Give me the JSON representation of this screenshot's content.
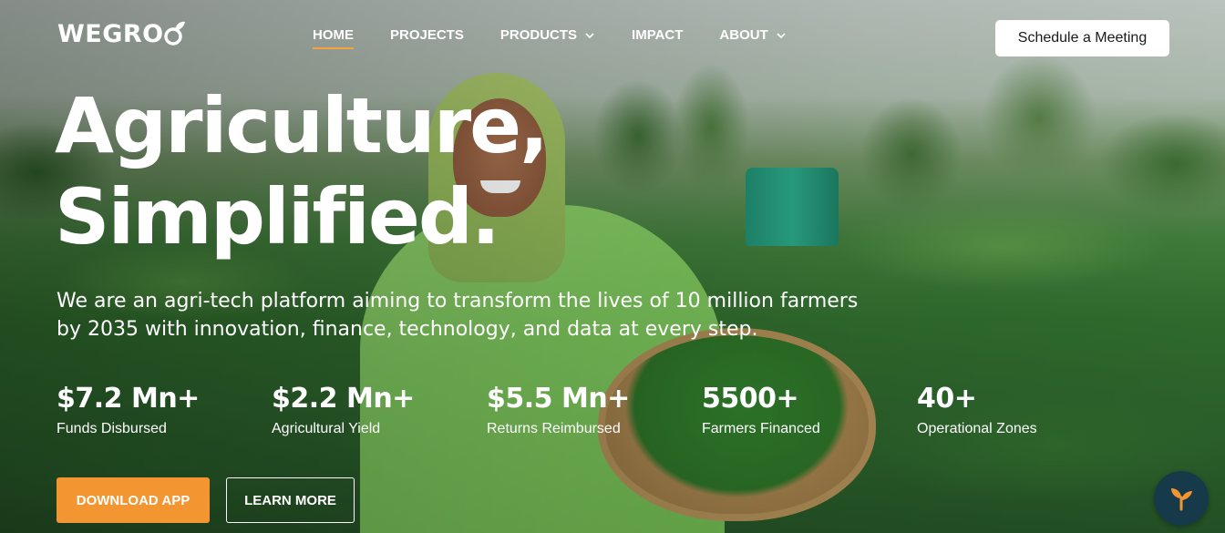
{
  "brand": {
    "logo_text": "WEGRO"
  },
  "nav": {
    "items": [
      {
        "label": "HOME",
        "active": true,
        "has_dropdown": false
      },
      {
        "label": "PROJECTS",
        "active": false,
        "has_dropdown": false
      },
      {
        "label": "PRODUCTS",
        "active": false,
        "has_dropdown": true
      },
      {
        "label": "IMPACT",
        "active": false,
        "has_dropdown": false
      },
      {
        "label": "ABOUT",
        "active": false,
        "has_dropdown": true
      }
    ],
    "cta_label": "Schedule a Meeting"
  },
  "hero": {
    "headline_line1": "Agriculture,",
    "headline_line2": "Simplified.",
    "subtitle": "We are an agri-tech platform aiming to transform the lives of 10 million farmers by 2035 with innovation, finance, technology, and data at every step."
  },
  "stats": [
    {
      "value": "$7.2 Mn+",
      "label": "Funds Disbursed"
    },
    {
      "value": "$2.2 Mn+",
      "label": "Agricultural Yield"
    },
    {
      "value": "$5.5 Mn+",
      "label": "Returns Reimbursed"
    },
    {
      "value": "5500+",
      "label": "Farmers Financed"
    },
    {
      "value": "40+",
      "label": "Operational Zones"
    }
  ],
  "buttons": {
    "download_label": "DOWNLOAD APP",
    "learn_label": "LEARN MORE"
  },
  "colors": {
    "accent_orange": "#f39531",
    "nav_underline": "#f5a33b",
    "chat_bg": "#173a4a"
  },
  "icons": {
    "logo_leaf": "leaf-icon",
    "dropdown": "chevron-down-icon",
    "chat": "sprout-icon"
  }
}
